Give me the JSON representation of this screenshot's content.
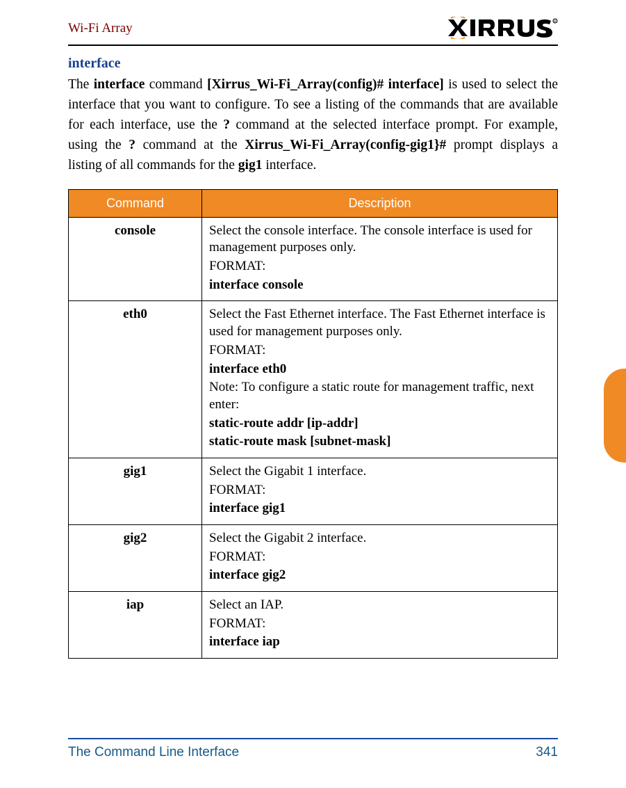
{
  "header": {
    "doc_title": "Wi-Fi Array",
    "logo_alt": "XIRRUS"
  },
  "section": {
    "heading": "interface",
    "para_parts": {
      "t1": "The ",
      "b1": "interface",
      "t2": " command ",
      "b2": "[Xirrus_Wi-Fi_Array(config)# interface]",
      "t3": " is used to select the interface that you want to configure. To see a listing of the commands that are available for each interface, use the ",
      "b3": "?",
      "t4": " command at the selected interface prompt. For example, using the ",
      "b4": "?",
      "t5": " command at the ",
      "b5": "Xirrus_Wi-Fi_Array(config-gig1}#",
      "t6": " prompt displays a listing of all commands for the ",
      "b6": "gig1",
      "t7": " interface."
    }
  },
  "table": {
    "headers": {
      "command": "Command",
      "description": "Description"
    },
    "rows": [
      {
        "cmd": "console",
        "lines": [
          {
            "text": "Select the console interface. The console interface is used for management purposes only.",
            "bold": false
          },
          {
            "text": "FORMAT:",
            "bold": false
          },
          {
            "text": "interface console",
            "bold": true
          }
        ]
      },
      {
        "cmd": "eth0",
        "lines": [
          {
            "text": "Select the Fast Ethernet interface. The Fast Ethernet interface is used for management purposes only.",
            "bold": false
          },
          {
            "text": "FORMAT:",
            "bold": false
          },
          {
            "text": "interface eth0",
            "bold": true
          },
          {
            "text": "Note: To configure a static route for management traffic, next enter:",
            "bold": false
          },
          {
            "text": "static-route addr [ip-addr]",
            "bold": true
          },
          {
            "text": "static-route mask [subnet-mask]",
            "bold": true
          }
        ]
      },
      {
        "cmd": "gig1",
        "lines": [
          {
            "text": "Select the Gigabit 1 interface.",
            "bold": false
          },
          {
            "text": "FORMAT:",
            "bold": false
          },
          {
            "text": "interface gig1",
            "bold": true
          }
        ]
      },
      {
        "cmd": "gig2",
        "lines": [
          {
            "text": "Select the Gigabit 2 interface.",
            "bold": false
          },
          {
            "text": "FORMAT:",
            "bold": false
          },
          {
            "text": "interface gig2",
            "bold": true
          }
        ]
      },
      {
        "cmd": "iap",
        "lines": [
          {
            "text": "Select an IAP.",
            "bold": false
          },
          {
            "text": "FORMAT:",
            "bold": false
          },
          {
            "text": "interface iap",
            "bold": true
          }
        ]
      }
    ]
  },
  "footer": {
    "left": "The Command Line Interface",
    "right": "341"
  }
}
